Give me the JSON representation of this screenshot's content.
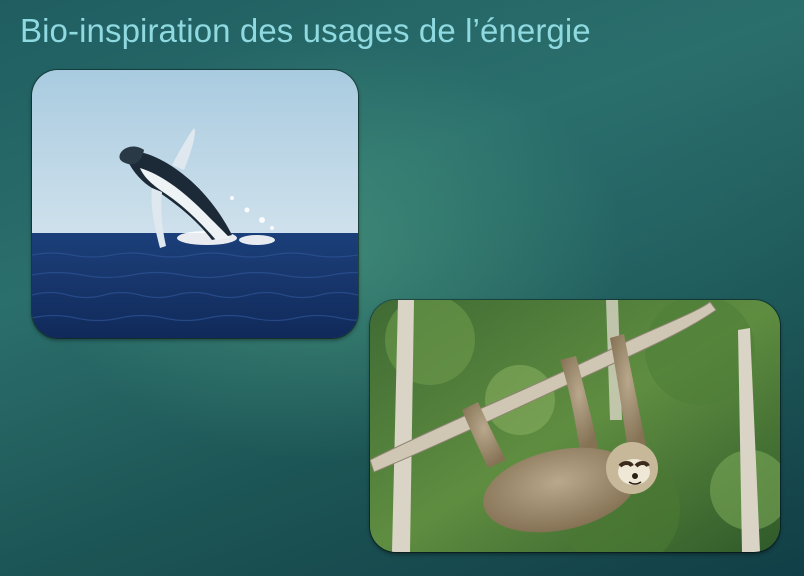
{
  "slide": {
    "title": "Bio-inspiration des usages de l’énergie"
  },
  "images": [
    {
      "subject": "humpback-whale-breaching"
    },
    {
      "subject": "sloth-hanging-on-branch"
    }
  ]
}
